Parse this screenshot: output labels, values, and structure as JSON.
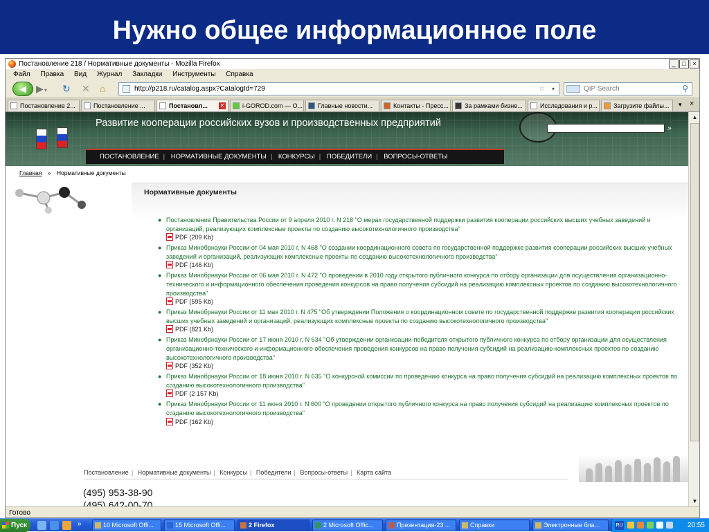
{
  "slide": {
    "title": "Нужно общее информационное поле"
  },
  "window": {
    "title": "Постановление 218 / Нормативные документы - Mozilla Firefox",
    "buttons": {
      "min": "_",
      "max": "□",
      "close": "×"
    }
  },
  "menu": [
    "Файл",
    "Правка",
    "Вид",
    "Журнал",
    "Закладки",
    "Инструменты",
    "Справка"
  ],
  "nav": {
    "url": "http://p218.ru/catalog.aspx?CatalogId=729",
    "search_placeholder": "QIP Search"
  },
  "tabs": [
    {
      "label": "Постановление 2..."
    },
    {
      "label": "Постановление ..."
    },
    {
      "label": "Постановл...",
      "active": true
    },
    {
      "label": "i-GOROD.com — О..."
    },
    {
      "label": "Главные новости..."
    },
    {
      "label": "Контакты - Пресс..."
    },
    {
      "label": "За рамками бизне..."
    },
    {
      "label": "Исследования и р..."
    },
    {
      "label": "Загрузите файлы..."
    }
  ],
  "site": {
    "banner_title": "Развитие кооперации российских вузов и производственных предприятий",
    "search_go": "»",
    "topnav": [
      "ПОСТАНОВЛЕНИЕ",
      "НОРМАТИВНЫЕ ДОКУМЕНТЫ",
      "КОНКУРСЫ",
      "ПОБЕДИТЕЛИ",
      "ВОПРОСЫ-ОТВЕТЫ"
    ],
    "breadcrumb": {
      "home": "Главная",
      "sep": "»",
      "current": "Нормативные документы"
    },
    "heading": "Нормативные документы",
    "documents": [
      {
        "title": "Постановление Правительства России от 9 апреля 2010 г. N 218 \"О мерах государственной поддержки развития кооперации российских высших учебных заведений и организаций, реализующих комплексные проекты по созданию высокотехнологичного производства\"",
        "pdf": "PDF (209 Kb)"
      },
      {
        "title": "Приказ Минобрнауки России от 04 мая 2010 г. N 468 \"О создании координационного совета по государственной поддержке развития кооперации российских высших учебных заведений и организаций, реализующих комплексные проекты по созданию высокотехнологичного производства\"",
        "pdf": "PDF (146 Kb)"
      },
      {
        "title": "Приказ Минобрнауки России от 06 мая 2010 г. N 472 \"О проведении в 2010 году открытого публичного конкурса по отбору организации для осуществления организационно-технического и информационного обеспечения проведения конкурсов на право получения субсидий на реализацию комплексных проектов по созданию высокотехнологичного производства\"",
        "pdf": "PDF (595 Kb)"
      },
      {
        "title": "Приказ Минобрнауки России от 11 мая 2010 г. N 475 \"Об утверждении Положения о координационном совете по государственной поддержке развития кооперации российских высших учебных заведений и организаций, реализующих комплексные проекты по созданию высокотехнологичного производства\"",
        "pdf": "PDF (821 Kb)"
      },
      {
        "title": "Приказ Минобрнауки России от 17 июня 2010 г. N 634 \"Об утверждении организации-победителя открытого публичного конкурса по отбору организации для осуществления организационно-технического и информационного обеспечения проведения конкурсов на право получения субсидий на реализацию комплексных проектов по созданию высокотехнологичного производства\"",
        "pdf": "PDF (352 Kb)"
      },
      {
        "title": "Приказ Минобрнауки России от 18 июня 2010 г. N 635 \"О конкурсной комиссии по проведению конкурса на право получения субсидий на реализацию комплексных проектов по созданию высокотехнологичного производства\"",
        "pdf": "PDF (2 157 Kb)"
      },
      {
        "title": "Приказ Минобрнауки России от 11 июня 2010 г. N 600 \"О проведении открытого публичного конкурса на право получения субсидий на реализацию комплексных проектов по созданию высокотехнологичного производства\"",
        "pdf": "PDF (162 Kb)"
      }
    ],
    "footnav": [
      "Постановление",
      "Нормативные документы",
      "Конкурсы",
      "Победители",
      "Вопросы-ответы",
      "Карта сайта"
    ],
    "phone1": "(495) 953-38-90",
    "phone2": "(495) 642-00-70"
  },
  "status": "Готово",
  "taskbar": {
    "start": "Пуск",
    "tasks": [
      {
        "label": "10 Microsoft Offi..."
      },
      {
        "label": "15 Microsoft Offi..."
      },
      {
        "label": "2 Firefox",
        "active": true
      },
      {
        "label": "2 Microsoft Offic..."
      },
      {
        "label": "Презентация-23 ..."
      },
      {
        "label": "Справки"
      },
      {
        "label": "Электронные бла..."
      }
    ],
    "lang": "RU",
    "clock": "20:55"
  }
}
